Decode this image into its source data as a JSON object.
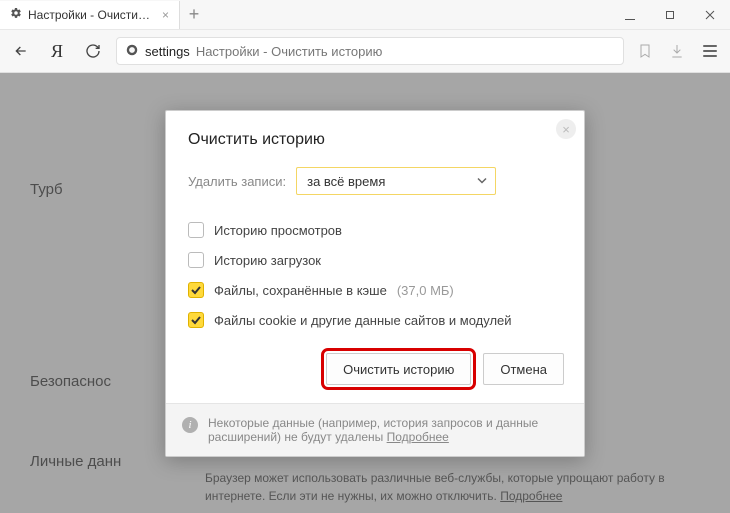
{
  "browser": {
    "tab_title": "Настройки - Очистить и",
    "url_host": "settings",
    "url_path": "Настройки - Очистить историю"
  },
  "backdrop": {
    "label_turbo": "Турб",
    "label_security": "Безопаснос",
    "label_personal": "Личные данн"
  },
  "dialog": {
    "title": "Очистить историю",
    "label": "Удалить записи:",
    "select_value": "за всё время",
    "checks": {
      "history": "Историю просмотров",
      "downloads": "Историю загрузок",
      "cache": "Файлы, сохранённые в кэше",
      "cache_size": "(37,0 МБ)",
      "cookies": "Файлы cookie и другие данные сайтов и модулей"
    },
    "primary": "Очистить историю",
    "cancel": "Отмена",
    "footer_text": "Некоторые данные (например, история запросов и данные расширений) не будут удалены ",
    "footer_link": "Подробнее"
  },
  "page_note": {
    "text": "Браузер может использовать различные веб-службы, которые упрощают работу в интернете. Если эти не нужны, их можно отключить. ",
    "link": "Подробнее"
  }
}
